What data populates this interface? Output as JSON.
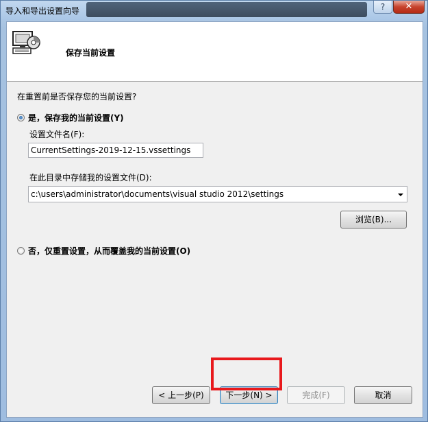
{
  "window": {
    "title": "导入和导出设置向导",
    "close_label": "✕",
    "help_label": "?"
  },
  "header": {
    "title": "保存当前设置",
    "icon": "settings-monitor-icon"
  },
  "question": "在重置前是否保存您的当前设置?",
  "option_save": {
    "label": "是，保存我的当前设置(Y)",
    "checked": true
  },
  "filename": {
    "label": "设置文件名(F):",
    "value": "CurrentSettings-2019-12-15.vssettings"
  },
  "directory": {
    "label": "在此目录中存储我的设置文件(D):",
    "value": "c:\\users\\administrator\\documents\\visual studio 2012\\settings"
  },
  "browse_label": "浏览(B)...",
  "option_overwrite": {
    "label": "否，仅重置设置，从而覆盖我的当前设置(O)",
    "checked": false
  },
  "footer": {
    "back_label": "< 上一步(P)",
    "next_label": "下一步(N) >",
    "finish_label": "完成(F)",
    "cancel_label": "取消"
  },
  "colors": {
    "highlight": "#e8191c",
    "accent": "#1e5799"
  }
}
